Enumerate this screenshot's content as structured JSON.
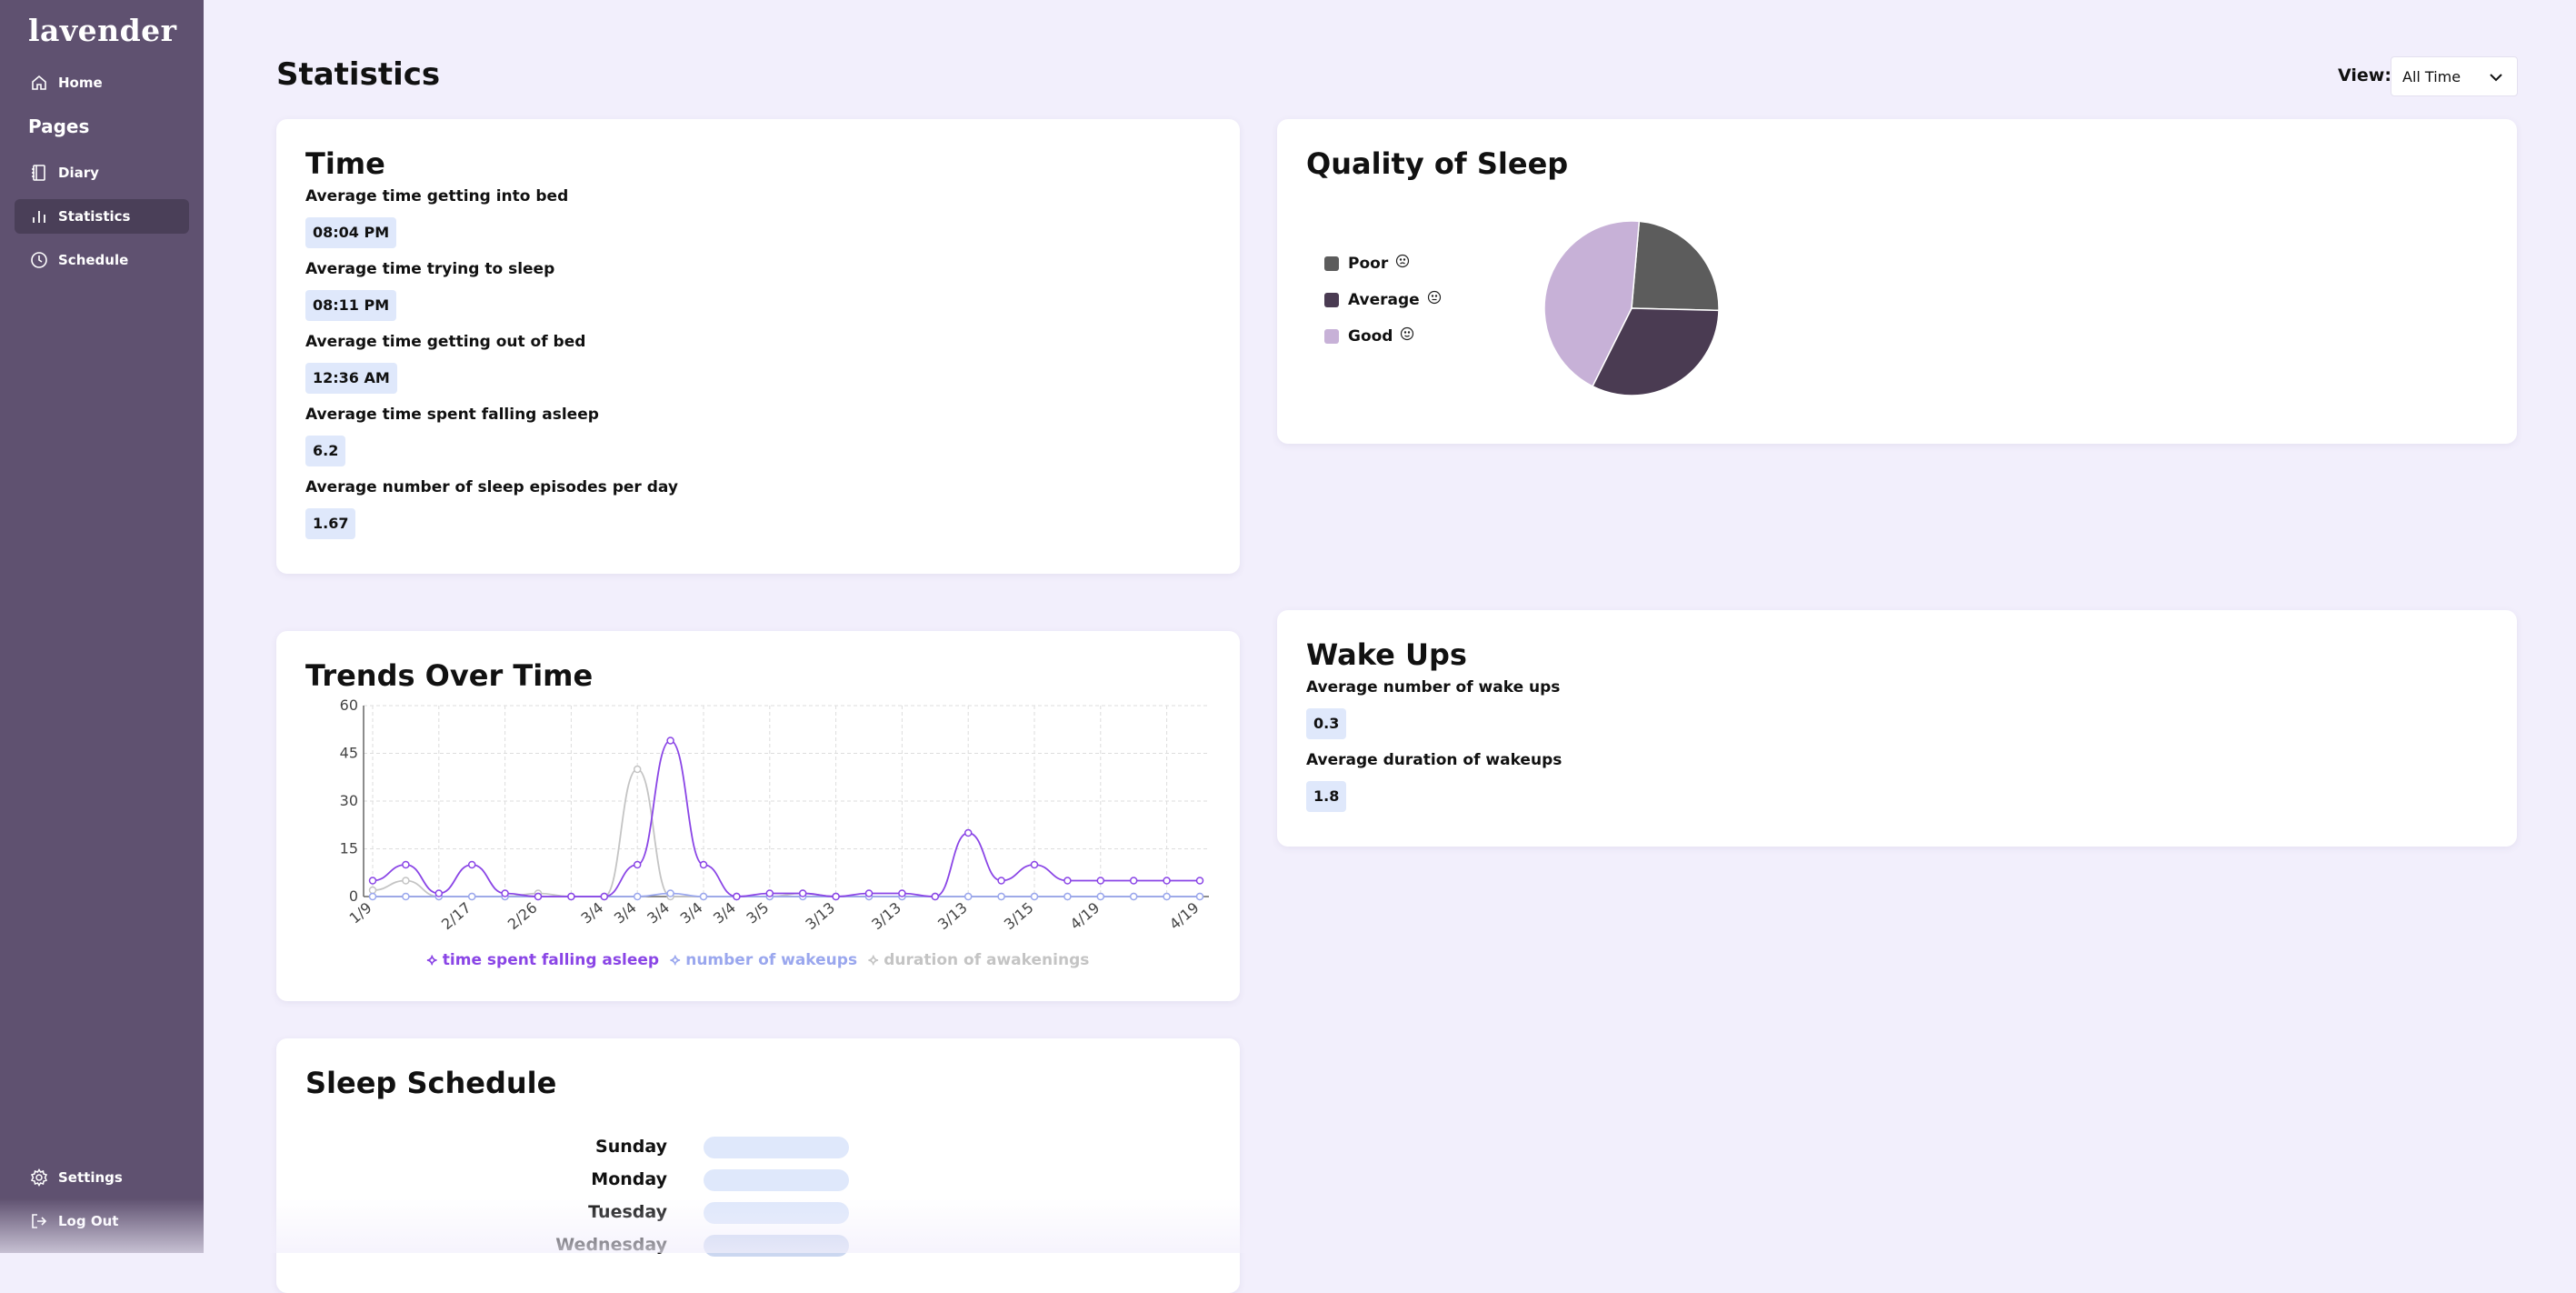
{
  "app": {
    "logo": "lavender"
  },
  "sidebar": {
    "home": "Home",
    "pages_heading": "Pages",
    "diary": "Diary",
    "statistics": "Statistics",
    "schedule": "Schedule",
    "settings": "Settings",
    "logout": "Log Out"
  },
  "header": {
    "title": "Statistics",
    "view_label": "View:",
    "view_value": "All Time"
  },
  "time_card": {
    "title": "Time",
    "stats": [
      {
        "label": "Average time getting into bed",
        "value": "08:04 PM"
      },
      {
        "label": "Average time trying to sleep",
        "value": "08:11 PM"
      },
      {
        "label": "Average time getting out of bed",
        "value": "12:36 AM"
      },
      {
        "label": "Average time spent falling asleep",
        "value": "6.2"
      },
      {
        "label": "Average number of sleep episodes per day",
        "value": "1.67"
      }
    ]
  },
  "quality_card": {
    "title": "Quality of Sleep",
    "legend": [
      {
        "label": "Poor",
        "color": "#5c5c5c"
      },
      {
        "label": "Average",
        "color": "#4a3b52"
      },
      {
        "label": "Good",
        "color": "#c7b1d7"
      }
    ]
  },
  "trends_card": {
    "title": "Trends Over Time"
  },
  "wake_card": {
    "title": "Wake Ups",
    "stats": [
      {
        "label": "Average number of wake ups",
        "value": "0.3"
      },
      {
        "label": "Average duration of wakeups",
        "value": "1.8"
      }
    ]
  },
  "schedule_card": {
    "title": "Sleep Schedule",
    "days": [
      "Sunday",
      "Monday",
      "Tuesday",
      "Wednesday"
    ]
  },
  "chart_data": [
    {
      "type": "pie",
      "labels": [
        "Poor",
        "Average",
        "Good"
      ],
      "values": [
        24,
        32,
        44
      ],
      "colors": [
        "#5c5c5c",
        "#4a3b52",
        "#c7b1d7"
      ]
    },
    {
      "type": "line",
      "x": [
        "1/9",
        "",
        "",
        "2/17",
        "",
        "2/26",
        "",
        "3/4",
        "3/4",
        "3/4",
        "3/4",
        "3/4",
        "3/5",
        "",
        "3/13",
        "",
        "3/13",
        "",
        "3/13",
        "",
        "3/15",
        "",
        "4/19",
        "",
        "",
        "4/19"
      ],
      "series": [
        {
          "name": "time spent falling asleep",
          "color": "#8a45e6",
          "values": [
            5,
            10,
            1,
            10,
            1,
            0,
            0,
            0,
            10,
            49,
            10,
            0,
            1,
            1,
            0,
            1,
            1,
            0,
            20,
            5,
            10,
            5,
            5,
            5,
            5,
            5
          ]
        },
        {
          "name": "number of wakeups",
          "color": "#9aa7ee",
          "values": [
            0,
            0,
            0,
            0,
            0,
            0,
            0,
            0,
            0,
            1,
            0,
            0,
            0,
            0,
            0,
            0,
            0,
            0,
            0,
            0,
            0,
            0,
            0,
            0,
            0,
            0
          ]
        },
        {
          "name": "duration of awakenings",
          "color": "#c4c4c4",
          "values": [
            2,
            5,
            0,
            0,
            0,
            1,
            0,
            0,
            40,
            0,
            0,
            0,
            0,
            1,
            0,
            0,
            0,
            0,
            0,
            0,
            0,
            0,
            0,
            0,
            0,
            0
          ]
        }
      ],
      "ylim": [
        0,
        60
      ],
      "yticks": [
        0,
        15,
        30,
        45,
        60
      ],
      "grid": true,
      "legend": "bottom"
    }
  ]
}
